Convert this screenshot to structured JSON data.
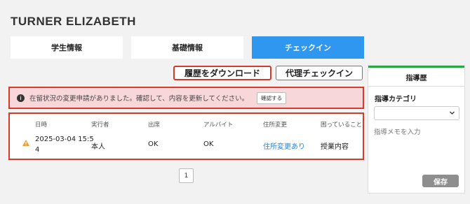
{
  "page": {
    "title": "TURNER ELIZABETH"
  },
  "tabs": [
    {
      "label": "学生情報"
    },
    {
      "label": "基礎情報"
    },
    {
      "label": "チェックイン"
    }
  ],
  "actions": {
    "download_history": "履歴をダウンロード",
    "proxy_checkin": "代理チェックイン"
  },
  "alert": {
    "icon": "info-icon",
    "message": "在留状況の変更申請がありました。確認して、内容を更新してください。",
    "confirm_label": "確認する"
  },
  "table": {
    "columns": [
      "日時",
      "実行者",
      "出席",
      "アルバイト",
      "住所変更",
      "困っていること"
    ],
    "rows": [
      {
        "status_icon": "warning-icon",
        "datetime_line1": "2025-03-04 15:5",
        "datetime_line2": "4",
        "executor": "本人",
        "attendance": "OK",
        "parttime": "OK",
        "address_change": "住所変更あり",
        "troubles": "授業内容"
      }
    ]
  },
  "pagination": {
    "current": "1"
  },
  "sidebar": {
    "title": "指導歴",
    "category_label": "指導カテゴリ",
    "category_value": "",
    "memo_placeholder": "指導メモを入力",
    "save_label": "保存"
  },
  "colors": {
    "accent": "#3097f0",
    "alert_bg": "#f8d7da",
    "highlight_border": "#d63a2a",
    "sidebar_top": "#28a745",
    "link": "#2a85d9"
  }
}
